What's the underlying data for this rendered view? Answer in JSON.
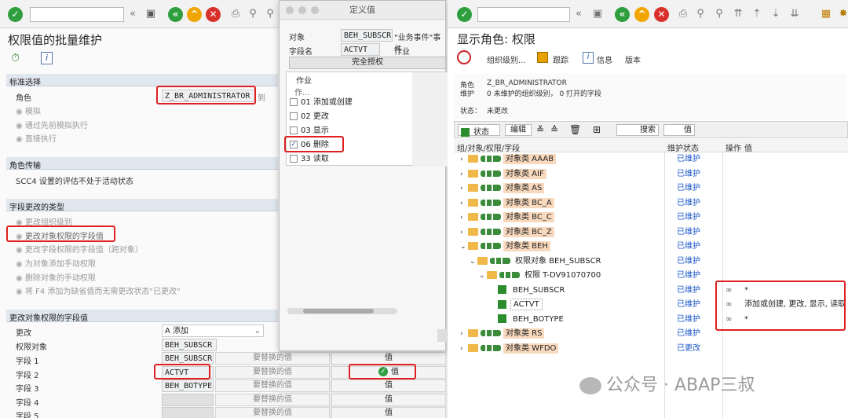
{
  "left": {
    "title": "权限值的批量维护",
    "sec1": {
      "header": "标准选择",
      "role_label": "角色",
      "role_value": "Z_BR_ADMINISTRATOR",
      "role_suffix": "到",
      "radios": [
        "模拟",
        "通过先前模拟执行",
        "直接执行"
      ]
    },
    "sec2": {
      "header": "角色传输",
      "text": "SCC4 设置的评估不处于活动状态"
    },
    "sec3": {
      "header": "字段更改的类型",
      "radios": [
        "更改组织级别",
        "更改对象权限的字段值",
        "更改字段权限的字段值（跨对象）",
        "为对象添加手动权限",
        "删除对象的手动权限",
        "将 F4 添加为缺省值而无需更改状态\"已更改\""
      ]
    },
    "sec4": {
      "header": "更改对象权限的字段值",
      "change_label": "更改",
      "change_value": "A 添加",
      "object_label": "权限对象",
      "object_value": "BEH_SUBSCR",
      "rows": [
        {
          "label": "字段 1",
          "value": "BEH_SUBSCR",
          "replace": "要替换的值",
          "val": "值"
        },
        {
          "label": "字段 2",
          "value": "ACTVT",
          "replace": "要替换的值",
          "val": "值"
        },
        {
          "label": "字段 3",
          "value": "BEH_BOTYPE",
          "replace": "要替换的值",
          "val": "值"
        },
        {
          "label": "字段 4",
          "value": "",
          "replace": "要替换的值",
          "val": "值"
        },
        {
          "label": "字段 5",
          "value": "",
          "replace": "要替换的值",
          "val": "值"
        }
      ]
    }
  },
  "dialog": {
    "title": "定义值",
    "object_label": "对象",
    "object_value": "BEH_SUBSCR",
    "object_desc": "\"业务事件\"事件",
    "field_label": "字段名",
    "field_value": "ACTVT",
    "field_desc": "作业",
    "full_auth": "完全授权",
    "col_header": "作业",
    "sub_header": "作...",
    "items": [
      {
        "code": "01",
        "label": "添加或创建",
        "checked": false
      },
      {
        "code": "02",
        "label": "更改",
        "checked": false
      },
      {
        "code": "03",
        "label": "显示",
        "checked": false
      },
      {
        "code": "06",
        "label": "删除",
        "checked": true
      },
      {
        "code": "33",
        "label": "读取",
        "checked": false
      }
    ]
  },
  "right": {
    "title": "显示角色: 权限",
    "toolbar": [
      "组织级别...",
      "跟踪",
      "信息",
      "版本"
    ],
    "info": {
      "role_label": "角色",
      "role_value": "Z_BR_ADMINISTRATOR",
      "maint_label": "维护",
      "maint_value": "0 未维护的组织级别， 0 打开的字段",
      "status_label": "状态：",
      "status_value": "未更改"
    },
    "tree_toolbar": [
      "状态",
      "编辑",
      "搜索",
      "值"
    ],
    "columns": [
      "组/对象/权限/字段",
      "维护状态",
      "操作",
      "值"
    ],
    "rows": [
      {
        "label": "对象类 AAAB",
        "status": "已维护",
        "op": "",
        "value": ""
      },
      {
        "label": "对象类 AIF",
        "status": "已维护",
        "op": "",
        "value": ""
      },
      {
        "label": "对象类 AS",
        "status": "已维护",
        "op": "",
        "value": ""
      },
      {
        "label": "对象类 BC_A",
        "status": "已维护",
        "op": "",
        "value": ""
      },
      {
        "label": "对象类 BC_C",
        "status": "已维护",
        "op": "",
        "value": ""
      },
      {
        "label": "对象类 BC_Z",
        "status": "已维护",
        "op": "",
        "value": ""
      },
      {
        "label": "对象类 BEH",
        "status": "已维护",
        "op": "",
        "value": ""
      },
      {
        "label": "权限对象 BEH_SUBSCR",
        "status": "已维护",
        "op": "",
        "value": ""
      },
      {
        "label": "权限 T-DV91070700",
        "status": "已维护",
        "op": "",
        "value": ""
      },
      {
        "label": "BEH_SUBSCR",
        "status": "已维护",
        "op": "👓",
        "value": "*"
      },
      {
        "label": "ACTVT",
        "status": "已维护",
        "op": "👓",
        "value": "添加或创建, 更改, 显示, 读取"
      },
      {
        "label": "BEH_BOTYPE",
        "status": "已维护",
        "op": "👓",
        "value": "*"
      },
      {
        "label": "对象类 RS",
        "status": "已维护",
        "op": "",
        "value": ""
      },
      {
        "label": "对象类 WFDO",
        "status": "已更改",
        "op": "",
        "value": ""
      }
    ],
    "watermark": "公众号 · ABAP三叔"
  }
}
